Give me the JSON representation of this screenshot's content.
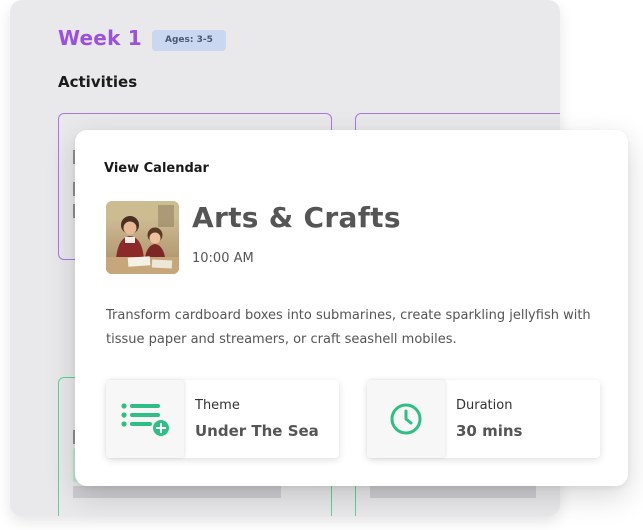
{
  "week": {
    "title": "Week 1",
    "age_badge": "Ages: 3-5"
  },
  "activities": {
    "heading": "Activities"
  },
  "modal": {
    "view_calendar": "View Calendar",
    "event": {
      "title": "Arts & Crafts",
      "time": "10:00 AM",
      "description": "Transform cardboard boxes into submarines, create sparkling jellyfish with tissue paper and streamers, or craft seashell mobiles.",
      "thumbnail_icon": "children-drawing-photo"
    },
    "theme": {
      "label": "Theme",
      "value": "Under The Sea",
      "icon": "list-add-icon"
    },
    "duration": {
      "label": "Duration",
      "value": "30 mins",
      "icon": "clock-icon"
    }
  },
  "colors": {
    "week_title": "#9b51e0",
    "accent_green": "#2fbf86",
    "purple_border": "#a978e6",
    "green_border": "#5ad49a"
  }
}
